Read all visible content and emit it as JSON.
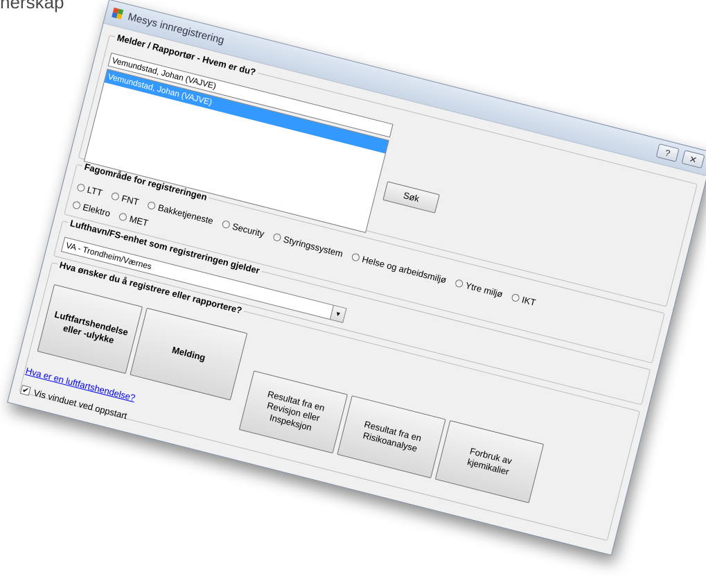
{
  "page_fragment": "nerskap",
  "window": {
    "title": "Mesys innregistrering"
  },
  "melder": {
    "legend": "Melder / Rapportør - Hvem er du?",
    "input_value": "Vemundstad, Johan (VAJVE)",
    "list_items": [
      "Vemundstad, Johan (VAJVE)"
    ],
    "search_button": "Søk"
  },
  "fagomrade": {
    "legend": "Fagområde for registreringen",
    "row1": [
      "LTT",
      "FNT",
      "Bakketjeneste",
      "Security",
      "Styringssystem",
      "Helse og arbeidsmiljø",
      "Ytre miljø",
      "IKT"
    ],
    "row2": [
      "Elektro",
      "MET"
    ]
  },
  "lufthavn": {
    "legend": "Lufthavn/FS-enhet som registreringen gjelder",
    "selected": "VA - Trondheim/Værnes"
  },
  "hva": {
    "legend": "Hva ønsker du å registrere eller rapportere?",
    "btn_luftfart": "Luftfartshendelse eller -ulykke",
    "btn_melding": "Melding",
    "btn_revisjon": "Resultat fra en Revisjon eller Inspeksjon",
    "btn_risiko": "Resultat fra en Risikoanalyse",
    "btn_kjemi": "Forbruk av kjemikalier"
  },
  "help_link": "Hva er en luftfartshendelse?",
  "startup_checkbox": {
    "label": "Vis vinduet ved oppstart",
    "checked": true
  },
  "icons": {
    "app": "app-icon",
    "help": "question-icon",
    "close": "close-icon"
  }
}
